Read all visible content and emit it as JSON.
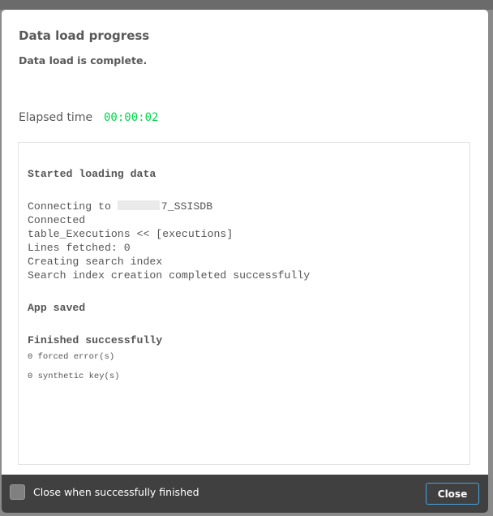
{
  "dialog": {
    "title": "Data load progress",
    "status": "Data load is complete.",
    "elapsed_label": "Elapsed time",
    "elapsed_value": "00:00:02",
    "log": {
      "started": "Started loading data",
      "connecting_prefix": "Connecting to ",
      "connecting_suffix": "7_SSISDB",
      "lines": [
        "Connected",
        "table_Executions << [executions]",
        "Lines fetched: 0",
        "Creating search index",
        "Search index creation completed successfully"
      ],
      "app_saved": "App saved",
      "finished": "Finished successfully",
      "forced_errors": "0 forced error(s)",
      "synthetic_keys": "0 synthetic key(s)"
    },
    "footer": {
      "checkbox_label": "Close when successfully finished",
      "checkbox_checked": false,
      "close_label": "Close"
    }
  },
  "colors": {
    "elapsed": "#00d94a",
    "footer": "#404040",
    "button_border": "#4aa3df"
  }
}
